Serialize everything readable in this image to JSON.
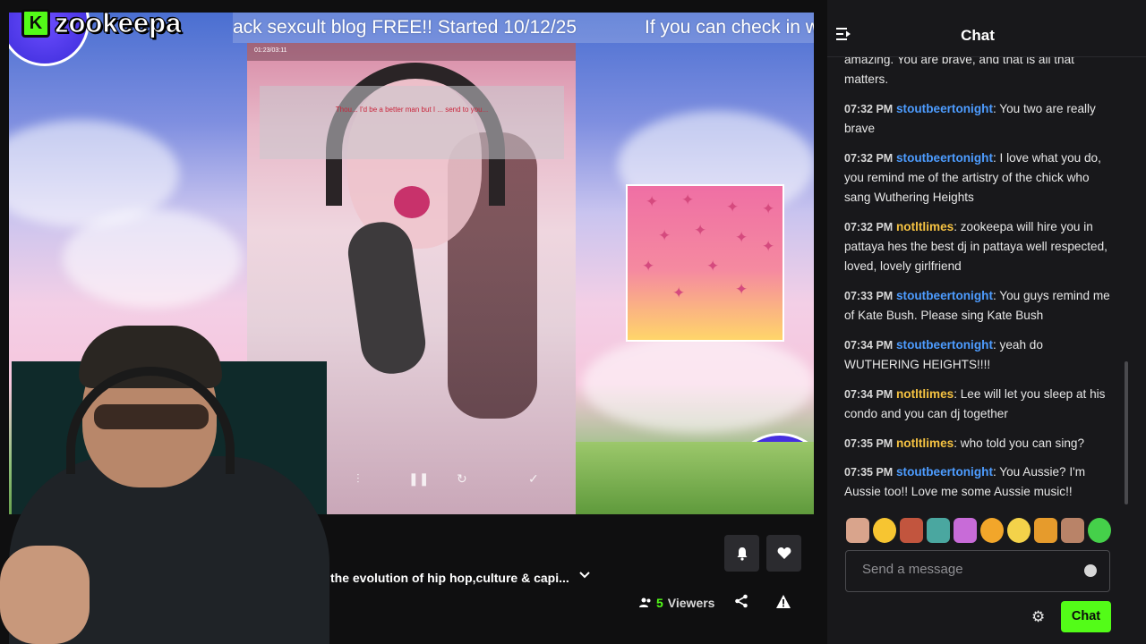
{
  "logo": {
    "letter": "K",
    "name": "zookeepa"
  },
  "ticker": {
    "segment_1": "ack sexcult blog FREE!! Started 10/12/25",
    "segment_2": "If you can check in wi"
  },
  "stream": {
    "video_timestamp": "01:23/03:11",
    "video_caption": "Thou... I'd be a better man but I ... send to you..."
  },
  "info": {
    "title": "the evolution of hip hop,culture & capi...",
    "viewer_count": "5",
    "viewer_label": "Viewers"
  },
  "chat": {
    "title": "Chat",
    "input_placeholder": "Send a message",
    "send_label": "Chat",
    "name_color_a": "#4d9cff",
    "name_color_b": "#f5c242",
    "messages": [
      {
        "time": "",
        "user": "",
        "text": "amazing. You are brave, and that is all that matters."
      },
      {
        "time": "07:32 PM",
        "user": "stoutbeertonight",
        "text": "You two are really brave"
      },
      {
        "time": "07:32 PM",
        "user": "stoutbeertonight",
        "text": "I love what you do, you remind me of the artistry of the chick who sang Wuthering Heights"
      },
      {
        "time": "07:32 PM",
        "user": "notltlimes",
        "text": "zookeepa will hire you in pattaya hes the best dj in pattaya well respected, loved, lovely girlfriend"
      },
      {
        "time": "07:33 PM",
        "user": "stoutbeertonight",
        "text": "You guys remind me of Kate Bush. Please sing Kate Bush"
      },
      {
        "time": "07:34 PM",
        "user": "stoutbeertonight",
        "text": "yeah do WUTHERING HEIGHTS!!!!"
      },
      {
        "time": "07:34 PM",
        "user": "notltlimes",
        "text": "Lee will let you sleep at his condo and you can dj together"
      },
      {
        "time": "07:35 PM",
        "user": "notltlimes",
        "text": "who told you can sing?"
      },
      {
        "time": "07:35 PM",
        "user": "stoutbeertonight",
        "text": "You Aussie? I'm Aussie too!! Love me some Aussie music!!"
      }
    ]
  }
}
